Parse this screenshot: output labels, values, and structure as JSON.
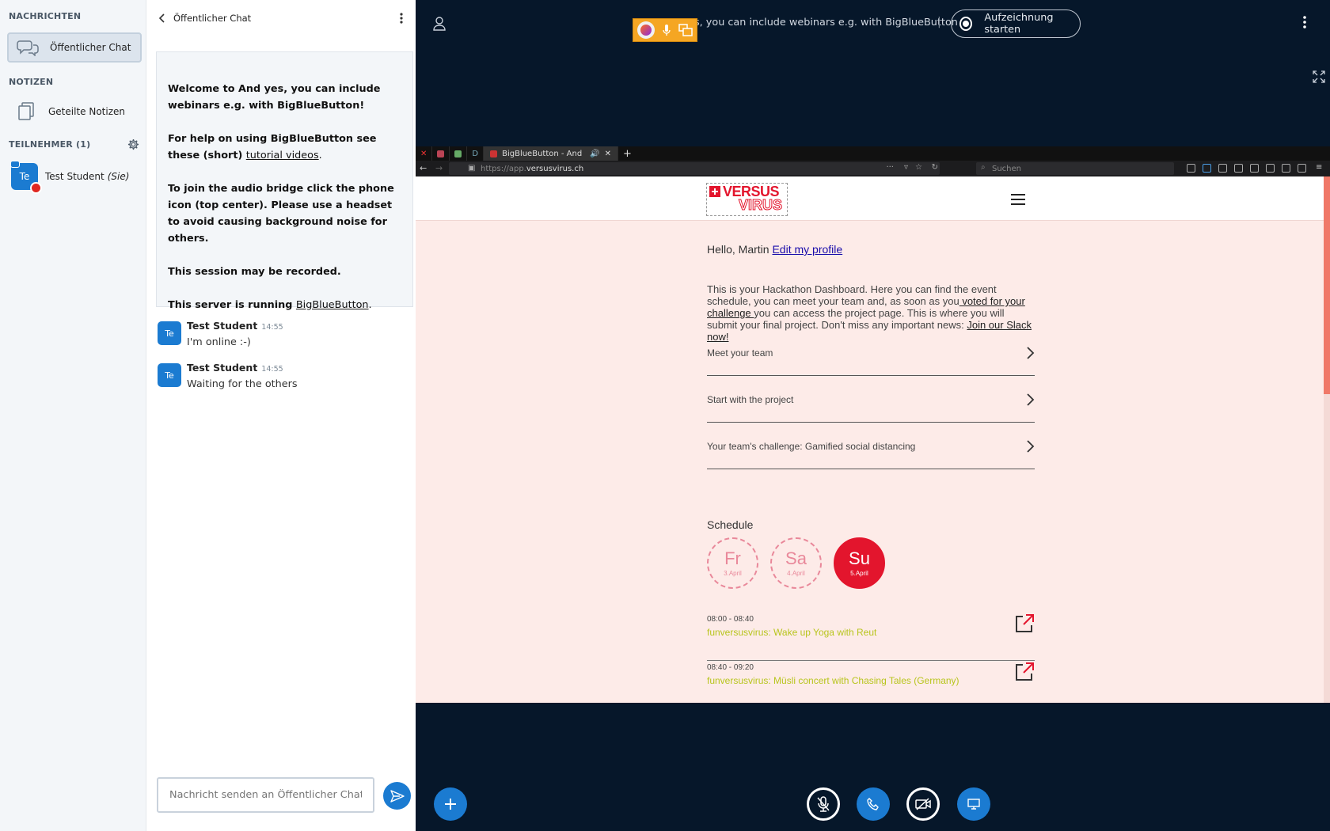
{
  "userlist": {
    "messages_title": "NACHRICHTEN",
    "public_chat": "Öffentlicher Chat",
    "notes_title": "NOTIZEN",
    "shared_notes": "Geteilte Notizen",
    "participants_title": "TEILNEHMER (1)",
    "user_initials": "Te",
    "user_name": "Test Student",
    "user_you": "(Sie)"
  },
  "chat": {
    "title": "Öffentlicher Chat",
    "welcome": {
      "w1": "Welcome to ",
      "w2": "And yes, you can include webinars e.g. with BigBlueButton",
      "w3": "!",
      "h1": "For help on using BigBlueButton see these (short) ",
      "h2": "tutorial videos",
      "h3": ".",
      "a1": "To join the audio bridge click the phone icon (top center). ",
      "a2": "Please use a headset to avoid causing background noise for others.",
      "rec": "This session may be recorded.",
      "s1": "This server is running ",
      "s2": "BigBlueButton",
      "s3": "."
    },
    "messages": [
      {
        "initials": "Te",
        "name": "Test Student",
        "time": "14:55",
        "text": "I'm online :-)"
      },
      {
        "initials": "Te",
        "name": "Test Student",
        "time": "14:55",
        "text": "Waiting for the others"
      }
    ],
    "input_placeholder": "Nachricht senden an Öffentlicher Chat"
  },
  "main": {
    "title": "s, you can include webinars e.g. with BigBlueButton",
    "separator": "|",
    "record_label": "Aufzeichnung starten"
  },
  "browser": {
    "tab_title": "BigBlueButton - And",
    "tab_d": "D",
    "url_prefix": "https://app.",
    "url_domain": "versusvirus.ch",
    "search_placeholder": "Suchen",
    "logo_top": "VERSUS",
    "logo_bottom": "VIRUS",
    "hello": "Hello, Martin ",
    "edit_profile": "Edit my profile",
    "intro_1": "This is your Hackathon Dashboard. Here you can find the event schedule, you can meet your team and, as soon as you",
    "intro_link1": " voted for your challenge ",
    "intro_2": "you can access the project page. This is where you will submit your final project. Don't miss any important news: ",
    "intro_link2": "Join our Slack now!",
    "accordion": [
      {
        "label": "Meet your team"
      },
      {
        "label": "Start with the project"
      },
      {
        "label": "Your team's challenge: Gamified social distancing"
      }
    ],
    "schedule_title": "Schedule",
    "days": [
      {
        "name": "Fr",
        "date": "3.April"
      },
      {
        "name": "Sa",
        "date": "4.April"
      },
      {
        "name": "Su",
        "date": "5.April"
      }
    ],
    "events": [
      {
        "time": "08:00 - 08:40",
        "name": "funversusvirus: Wake up Yoga with Reut"
      },
      {
        "time": "08:40 - 09:20",
        "name": "funversusvirus: Müsli concert with Chasing Tales (Germany)"
      }
    ]
  }
}
